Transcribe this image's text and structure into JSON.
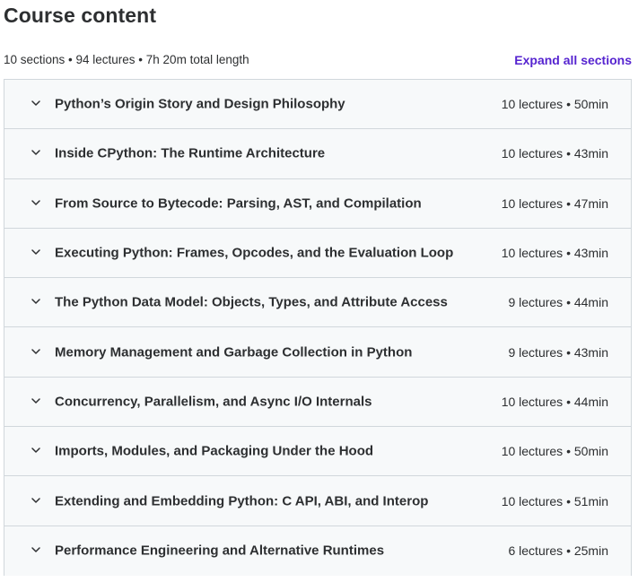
{
  "header": {
    "title": "Course content",
    "summary": "10 sections • 94 lectures • 7h 20m total length",
    "expand_all_label": "Expand all sections"
  },
  "colors": {
    "link": "#5624d0",
    "section_bg": "#f7f9fa",
    "border": "#d1d7dc",
    "text": "#2d2f31"
  },
  "sections": [
    {
      "title": "Python’s Origin Story and Design Philosophy",
      "meta": "10 lectures • 50min",
      "icon": "chevron-down-icon"
    },
    {
      "title": "Inside CPython: The Runtime Architecture",
      "meta": "10 lectures • 43min",
      "icon": "chevron-down-icon"
    },
    {
      "title": "From Source to Bytecode: Parsing, AST, and Compilation",
      "meta": "10 lectures • 47min",
      "icon": "chevron-down-icon"
    },
    {
      "title": "Executing Python: Frames, Opcodes, and the Evaluation Loop",
      "meta": "10 lectures • 43min",
      "icon": "chevron-down-icon"
    },
    {
      "title": "The Python Data Model: Objects, Types, and Attribute Access",
      "meta": "9 lectures • 44min",
      "icon": "chevron-down-icon"
    },
    {
      "title": "Memory Management and Garbage Collection in Python",
      "meta": "9 lectures • 43min",
      "icon": "chevron-down-icon"
    },
    {
      "title": "Concurrency, Parallelism, and Async I/O Internals",
      "meta": "10 lectures • 44min",
      "icon": "chevron-down-icon"
    },
    {
      "title": "Imports, Modules, and Packaging Under the Hood",
      "meta": "10 lectures • 50min",
      "icon": "chevron-down-icon"
    },
    {
      "title": "Extending and Embedding Python: C API, ABI, and Interop",
      "meta": "10 lectures • 51min",
      "icon": "chevron-down-icon"
    },
    {
      "title": "Performance Engineering and Alternative Runtimes",
      "meta": "6 lectures • 25min",
      "icon": "chevron-down-icon"
    }
  ]
}
